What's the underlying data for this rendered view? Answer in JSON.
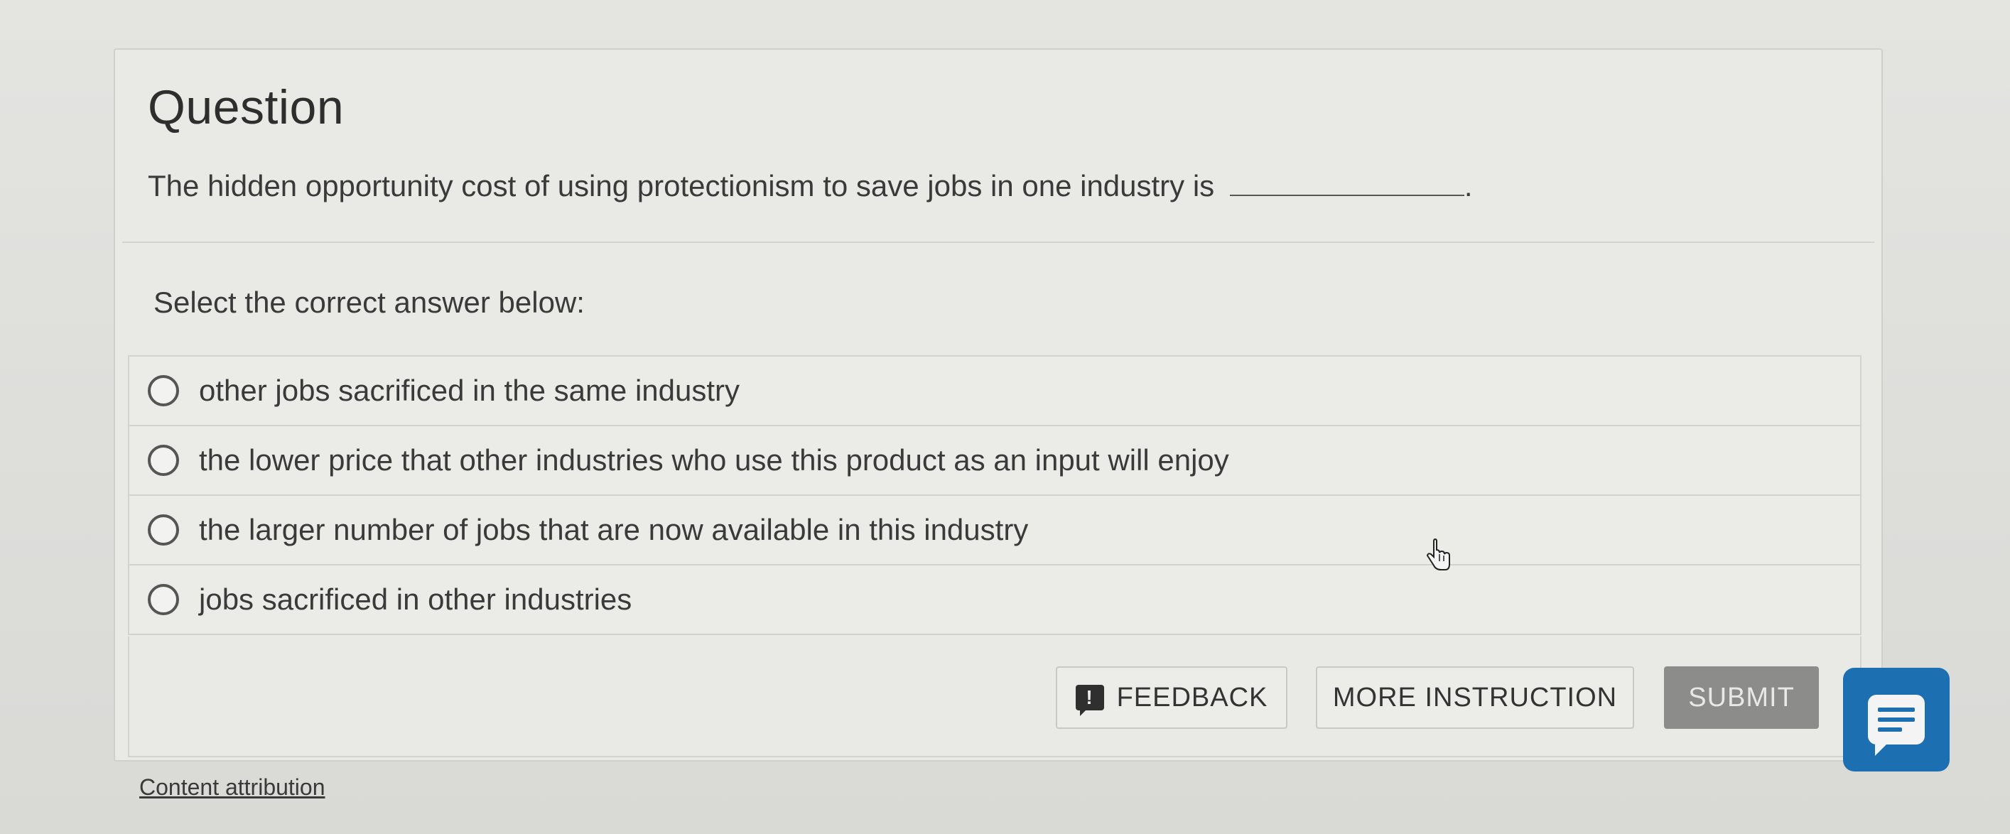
{
  "question": {
    "title": "Question",
    "text": "The hidden opportunity cost of using protectionism to save jobs in one industry is",
    "period": "."
  },
  "prompt": "Select the correct answer below:",
  "options": [
    {
      "label": "other jobs sacrificed in the same industry",
      "selected": false
    },
    {
      "label": "the lower price that other industries who use this product as an input will enjoy",
      "selected": false
    },
    {
      "label": "the larger number of jobs that are now available in this industry",
      "selected": false
    },
    {
      "label": "jobs sacrificed in other industries",
      "selected": false
    }
  ],
  "buttons": {
    "feedback": "FEEDBACK",
    "feedback_icon": "!",
    "more_instruction": "MORE INSTRUCTION",
    "submit": "SUBMIT"
  },
  "footer": {
    "attribution": "Content attribution"
  },
  "icons": {
    "feedback": "feedback-icon",
    "chat": "chat-icon",
    "cursor": "hand-cursor-icon"
  },
  "colors": {
    "submit_bg": "#8c8c8a",
    "chat_bg": "#1c6fb0"
  }
}
